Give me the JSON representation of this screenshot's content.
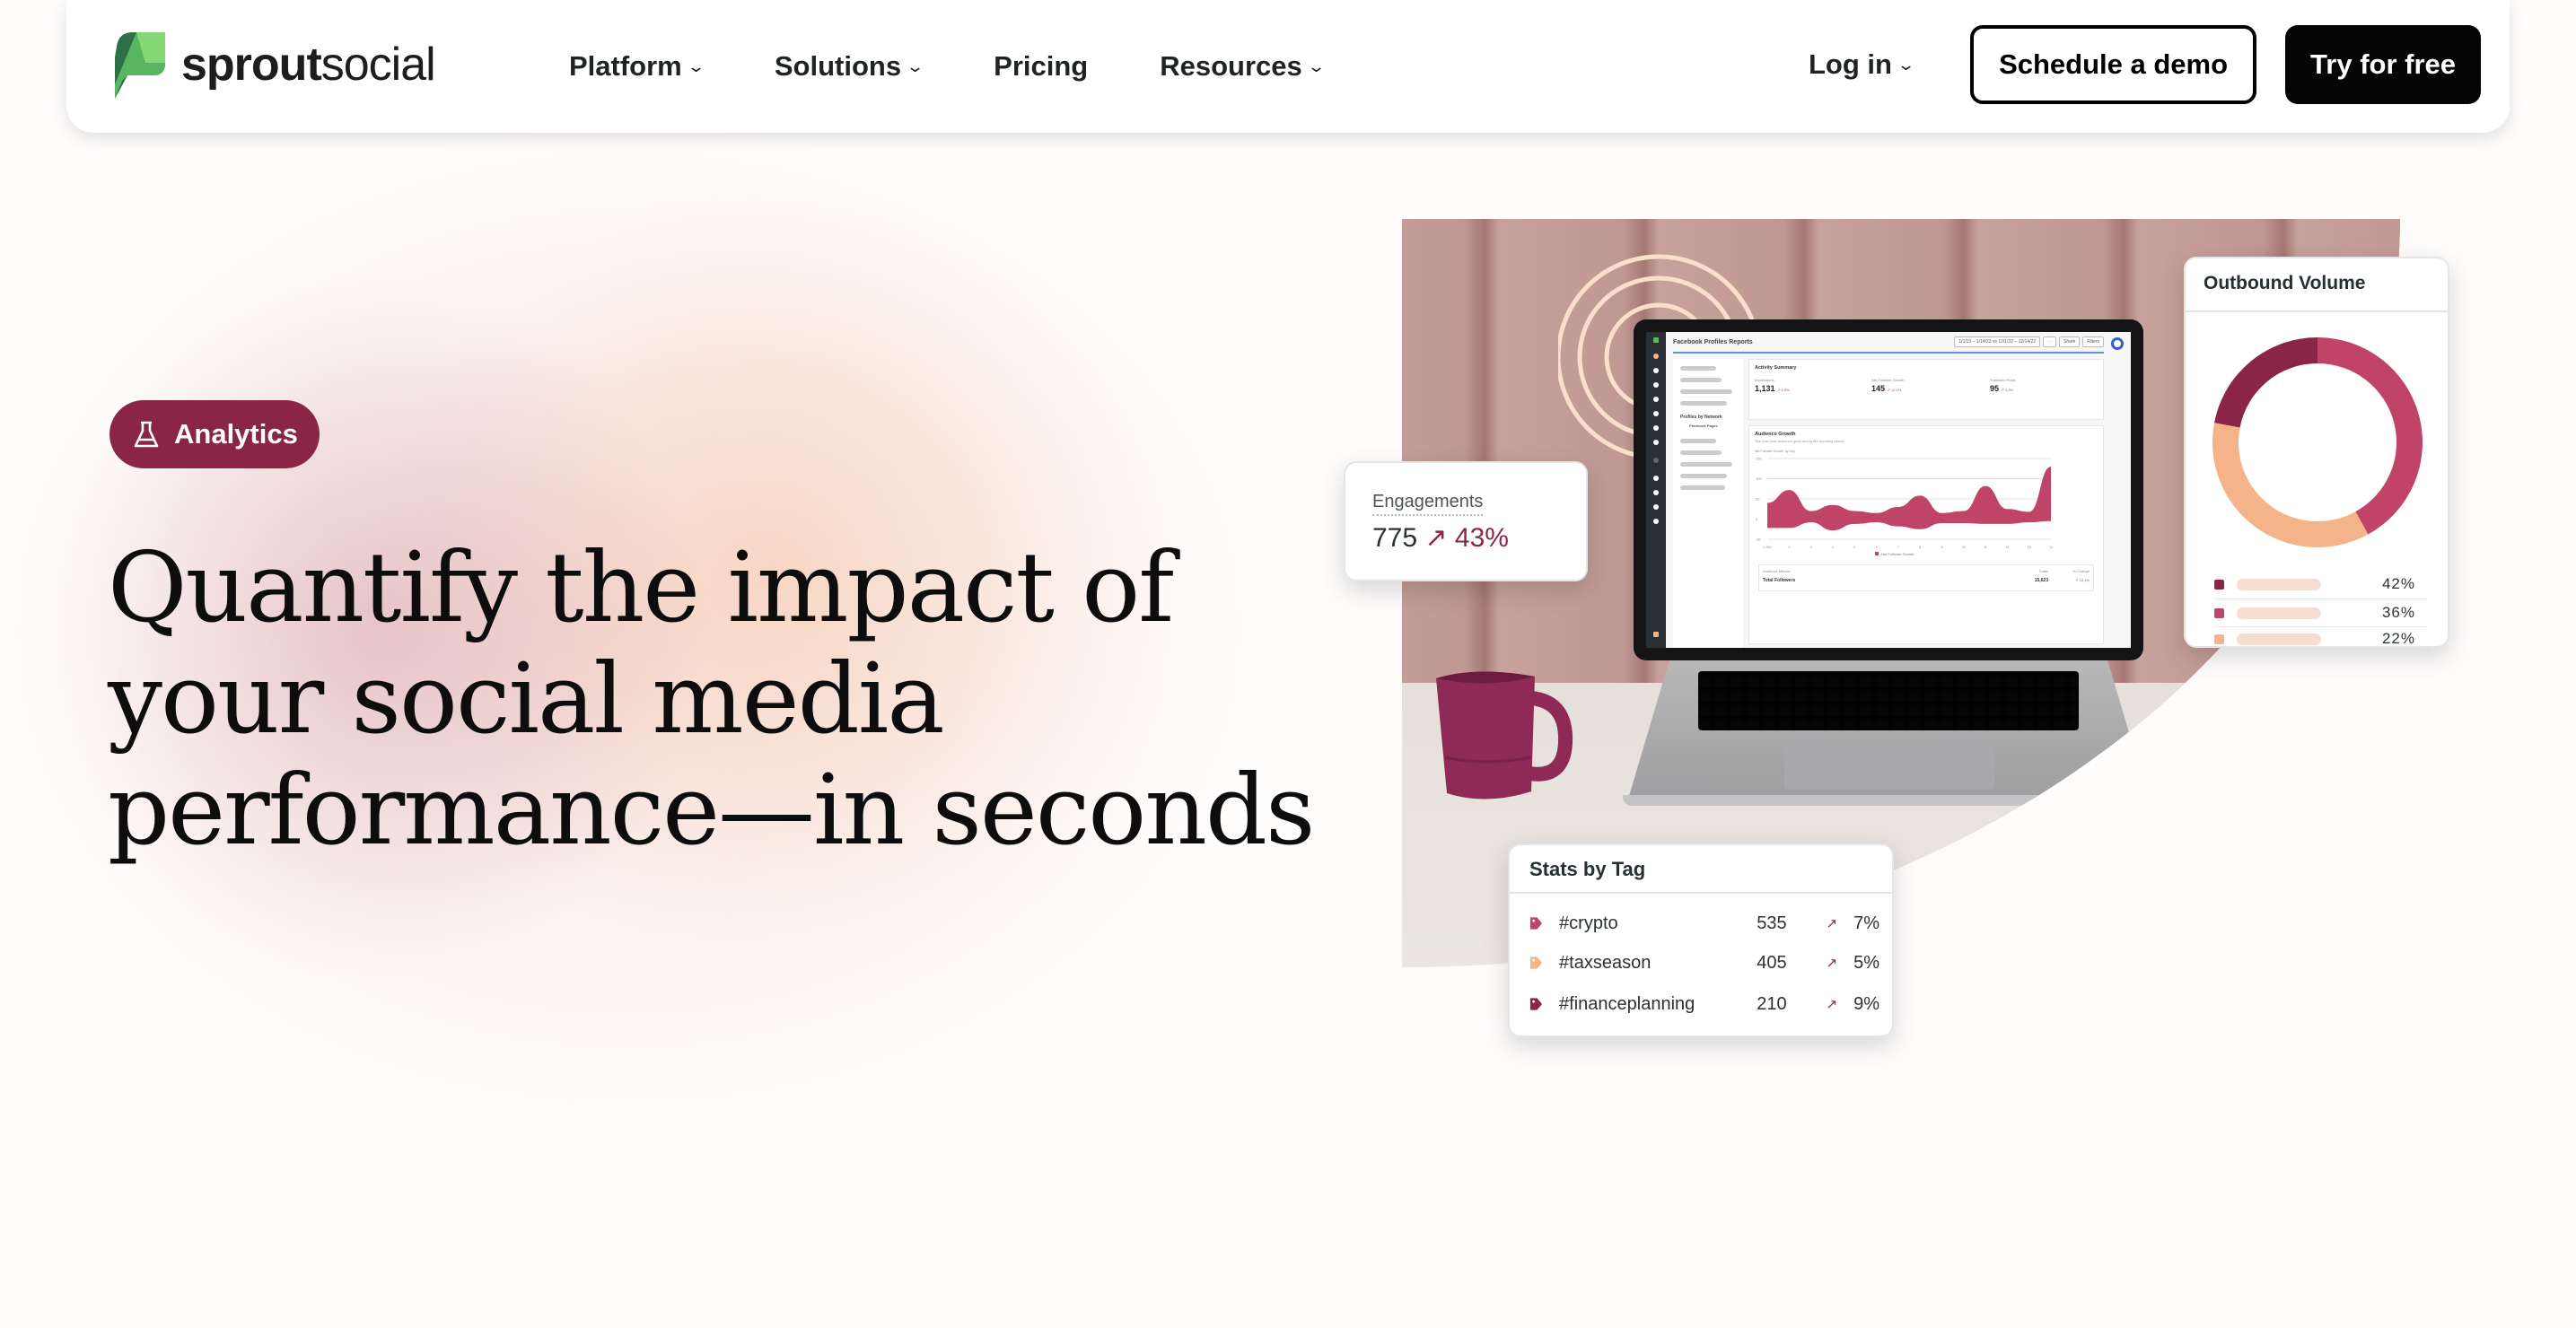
{
  "brand": {
    "name_bold": "sprout",
    "name_light": "social"
  },
  "nav": {
    "links": [
      {
        "label": "Platform",
        "has_dropdown": true
      },
      {
        "label": "Solutions",
        "has_dropdown": true
      },
      {
        "label": "Pricing",
        "has_dropdown": false
      },
      {
        "label": "Resources",
        "has_dropdown": true
      }
    ],
    "login_label": "Log in",
    "demo_label": "Schedule a demo",
    "try_label": "Try for free",
    "chevron": "⌄"
  },
  "hero": {
    "badge_label": "Analytics",
    "badge_icon": "flask-icon",
    "headline_lines": [
      "Quantify the impact of",
      "your social media",
      "performance—in seconds"
    ]
  },
  "engagements_card": {
    "label": "Engagements",
    "value": "775",
    "arrow": "↗",
    "change": "43%"
  },
  "outbound_volume_card": {
    "title": "Outbound Volume",
    "segments": [
      {
        "percent_label": "42%",
        "value": 42,
        "color": "#c04468"
      },
      {
        "percent_label": "36%",
        "value": 36,
        "color": "#f4b389"
      },
      {
        "percent_label": "22%",
        "value": 22,
        "color": "#8a2548"
      }
    ],
    "legend": [
      {
        "percent_label": "42%",
        "color": "#8a2548"
      },
      {
        "percent_label": "36%",
        "color": "#c04468"
      },
      {
        "percent_label": "22%",
        "color": "#f4b389"
      }
    ]
  },
  "stats_by_tag_card": {
    "title": "Stats by Tag",
    "rows": [
      {
        "tag": "#crypto",
        "count": "535",
        "arrow": "↗",
        "change": "7%",
        "color": "#c04468"
      },
      {
        "tag": "#taxseason",
        "count": "405",
        "arrow": "↗",
        "change": "5%",
        "color": "#f4b389"
      },
      {
        "tag": "#financeplanning",
        "count": "210",
        "arrow": "↗",
        "change": "9%",
        "color": "#8a2548"
      }
    ]
  },
  "laptop_screen": {
    "title": "Facebook Profiles Reports",
    "toolbar": [
      "1/1/23 – 1/14/23 vs 12/1/22 – 12/14/22",
      "···",
      "Share",
      "Filters"
    ],
    "left_panel": {
      "section_label": "Profiles by Network",
      "sub_label": "Facebook Pages"
    },
    "activity_summary": {
      "title": "Activity Summary",
      "kpis": [
        {
          "label": "Impressions",
          "value": "1,131",
          "change": "↗ 5.5%"
        },
        {
          "label": "Net Follower Growth",
          "value": "145",
          "change": "↗ 12.1%"
        },
        {
          "label": "Published Posts",
          "value": "95",
          "change": "↗ 1.2%"
        }
      ]
    },
    "audience_growth": {
      "title": "Audience Growth",
      "subtitle": "See how your audience grew during the reporting period.",
      "chart_label": "Net Follower Growth, by Day",
      "legend": "Net Follower Growth"
    },
    "audience_metrics": {
      "headers": [
        "Audience Metrics",
        "Totals",
        "% Change"
      ],
      "row": {
        "label": "Total Followers",
        "total": "15,623",
        "change": "↗ 12.1%"
      }
    }
  },
  "chart_data": {
    "type": "area",
    "title": "Net Follower Growth, by Day",
    "xlabel": "",
    "ylabel": "",
    "x": [
      "1 JAN",
      "2",
      "3",
      "4",
      "5",
      "6",
      "7",
      "8",
      "9",
      "10",
      "11",
      "12",
      "13",
      "14"
    ],
    "ylim": [
      -50,
      150
    ],
    "yticks": [
      -50,
      0,
      50,
      100,
      150
    ],
    "series": [
      {
        "name": "Net Follower Growth (upper)",
        "values": [
          40,
          72,
          20,
          35,
          20,
          15,
          30,
          58,
          15,
          20,
          82,
          25,
          18,
          130
        ]
      },
      {
        "name": "Net Follower Growth (lower)",
        "values": [
          -22,
          -22,
          -8,
          -28,
          -12,
          -8,
          -18,
          -25,
          -10,
          -10,
          -12,
          -12,
          -8,
          -5
        ]
      }
    ],
    "color": "#c04468",
    "legend": "bottom"
  }
}
